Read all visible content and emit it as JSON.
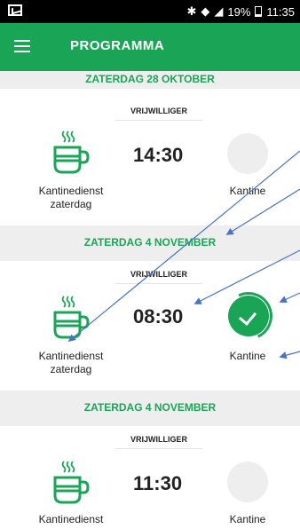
{
  "statusbar": {
    "battery": "19%",
    "time": "11:35"
  },
  "header": {
    "title": "PROGRAMMA",
    "menu_icon": "hamburger-icon"
  },
  "sections": [
    {
      "date": "ZATERDAG 28 OKTOBER",
      "role": "VRIJWILLIGER",
      "time": "14:30",
      "task": "Kantinedienst zaterdag",
      "location": "Kantine",
      "checked": false
    },
    {
      "date": "ZATERDAG 4 NOVEMBER",
      "role": "VRIJWILLIGER",
      "time": "08:30",
      "task": "Kantinedienst zaterdag",
      "location": "Kantine",
      "checked": true
    },
    {
      "date": "ZATERDAG 4 NOVEMBER",
      "role": "VRIJWILLIGER",
      "time": "11:30",
      "task": "Kantinedienst",
      "location": "Kantine",
      "checked": false
    }
  ],
  "colors": {
    "accent": "#1aa556",
    "band": "#eeeeee",
    "annotation": "#4a72c4"
  }
}
